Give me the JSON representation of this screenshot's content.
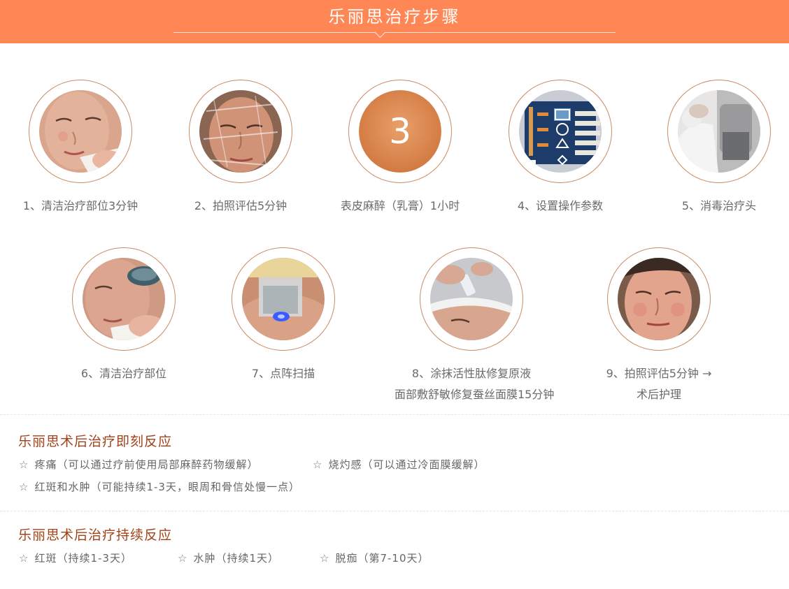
{
  "header": {
    "title": "乐丽思治疗步骤"
  },
  "steps": [
    {
      "label": "1、清洁治疗部位3分钟",
      "icon": "face-cleansing-photo"
    },
    {
      "label": "2、拍照评估5分钟",
      "icon": "face-film-photo"
    },
    {
      "label": "表皮麻醉（乳膏）1小时",
      "number": "3"
    },
    {
      "label": "4、设置操作参数",
      "icon": "device-panel-photo"
    },
    {
      "label": "5、消毒治疗头",
      "icon": "handpiece-disinfect-photo"
    },
    {
      "label": "6、清洁治疗部位",
      "icon": "face-wipe-photo"
    },
    {
      "label": "7、点阵扫描",
      "icon": "laser-scan-photo"
    },
    {
      "label": "8、涂抹活性肽修复原液",
      "label2": "面部敷舒敏修复蚕丝面膜15分钟",
      "icon": "serum-apply-photo"
    },
    {
      "label": "9、拍照评估5分钟 →",
      "label2": "术后护理",
      "icon": "face-result-photo"
    }
  ],
  "immediate": {
    "title": "乐丽思术后治疗即刻反应",
    "items": [
      "疼痛（可以通过疗前使用局部麻醉药物缓解）",
      "烧灼感（可以通过冷面膜缓解）",
      "红斑和水肿（可能持续1-3天，眼周和骨信处慢一点）"
    ]
  },
  "persistent": {
    "title": "乐丽思术后治疗持续反应",
    "items": [
      "红斑（持续1-3天）",
      "水肿（持续1天）",
      "脱痂（第7-10天）"
    ]
  },
  "colors": {
    "banner": "#ff8755",
    "ring": "#c98a62",
    "section_title": "#a0431a",
    "number_disc": "#e08a55"
  }
}
